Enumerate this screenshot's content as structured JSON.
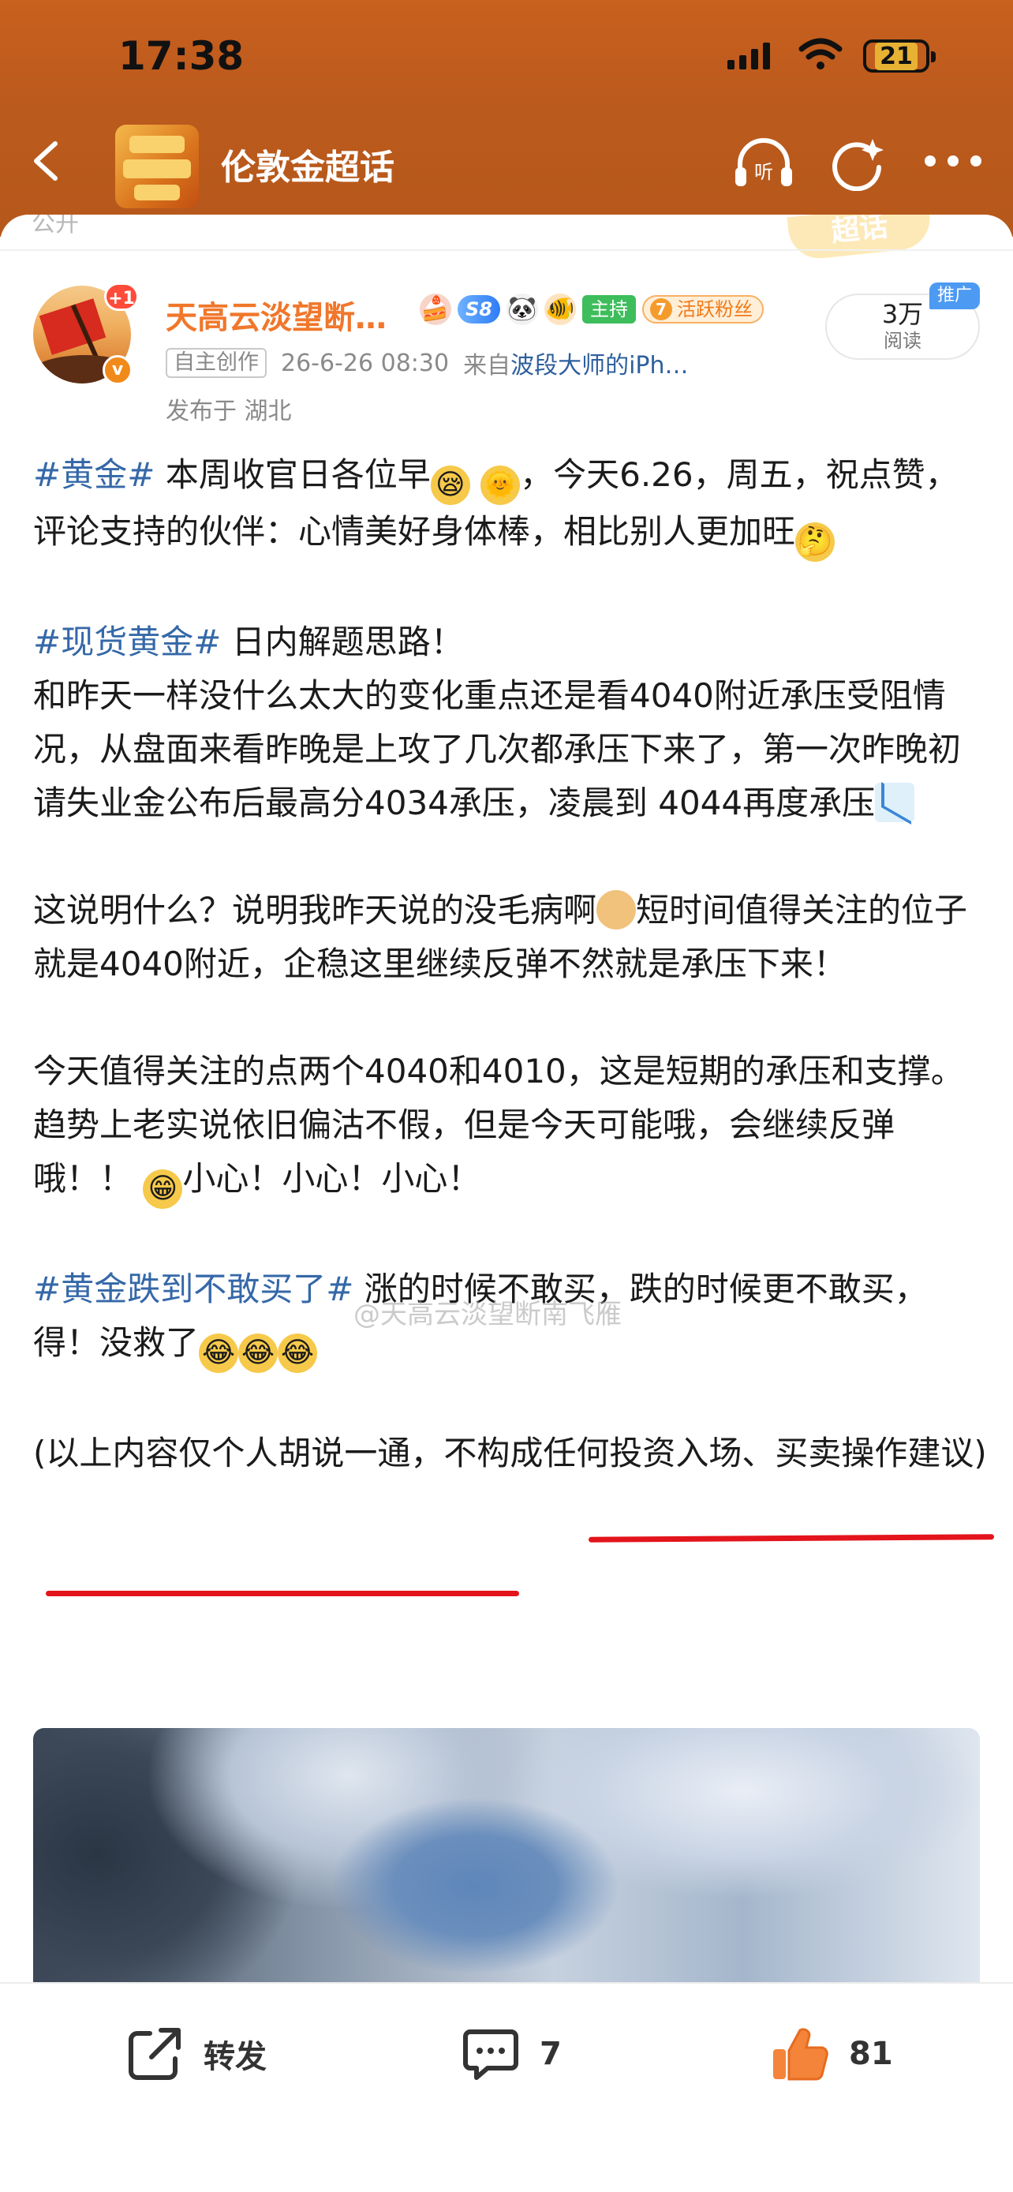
{
  "status_bar": {
    "time": "17:38",
    "battery": "21"
  },
  "nav": {
    "title": "伦敦金超话"
  },
  "scroll_hint": "公开",
  "watermark_badge": "超话",
  "author": {
    "name": "天高云淡望断…",
    "notification_badge": "+1",
    "badges": {
      "level": "S8",
      "host": "主持",
      "fans_level": "7",
      "fans": "活跃粉丝"
    }
  },
  "meta": {
    "original_tag": "自主创作",
    "datetime": "26-6-26 08:30",
    "source_prefix": "来自",
    "source_name": "波段大师的iPh…",
    "location": "发布于 湖北"
  },
  "read": {
    "count": "3万",
    "label": "阅读",
    "promo": "推广"
  },
  "post": {
    "p1_tag": "#黄金#",
    "p1_a": " 本周收官日各位早",
    "p1_b": "，今天6.26，周五，祝点赞，评论支持的伙伴：心情美好身体棒，相比别人更加旺",
    "p2_tag": "#现货黄金#",
    "p2_a": " 日内解题思路！",
    "p2_b": "和昨天一样没什么太大的变化重点还是看4040附近承压受阻情况，从盘面来看昨晚是上攻了几次都承压下来了，第一次昨晚初请失业金公布后最高分4034承压，凌晨到 4044再度承压",
    "p3_a": "这说明什么？说明我昨天说的没毛病啊",
    "p3_b": "短时间值得关注的位子就是4040附近，企稳这里继续反弹不然就是承压下来！",
    "p4_a": "今天值得关注的点两个4040和4010，这是短期的承压和支撑。趋势上老实说依旧偏沽不假，但是今天可能哦，会继续反弹哦！！",
    "p4_b": "小心！小心！小心！",
    "p5_tag": "#黄金跌到不敢买了#",
    "p5_a": " 涨的时候不敢买，跌的时候更不敢买，得！没救了",
    "p6": "(以上内容仅个人胡说一通，不构成任何投资入场、买卖操作建议)"
  },
  "watermark": "@天高云淡望断南飞雁",
  "actions": {
    "repost": "转发",
    "comment_count": "7",
    "like_count": "81"
  },
  "colors": {
    "header": "#c25d1d",
    "username": "#f0772b",
    "hashtag": "#3568a8",
    "underline": "#e3141c",
    "like": "#f3843a"
  }
}
